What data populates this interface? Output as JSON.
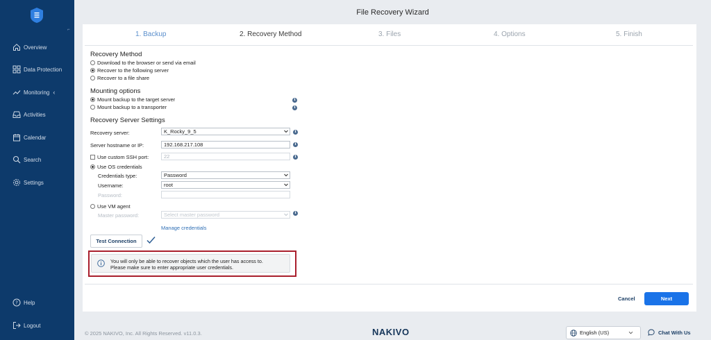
{
  "window_title": "File Recovery Wizard",
  "sidebar": {
    "items": [
      {
        "label": "Overview",
        "icon": "home-icon"
      },
      {
        "label": "Data Protection",
        "icon": "grid-icon"
      },
      {
        "label": "Monitoring",
        "icon": "trend-icon"
      },
      {
        "label": "Activities",
        "icon": "inbox-icon"
      },
      {
        "label": "Calendar",
        "icon": "calendar-icon"
      },
      {
        "label": "Search",
        "icon": "search-icon"
      },
      {
        "label": "Settings",
        "icon": "gear-icon"
      }
    ],
    "bottom_items": [
      {
        "label": "Help",
        "icon": "help-icon"
      },
      {
        "label": "Logout",
        "icon": "logout-icon"
      }
    ]
  },
  "steps": [
    "1. Backup",
    "2. Recovery Method",
    "3. Files",
    "4. Options",
    "5. Finish"
  ],
  "recovery_method": {
    "title": "Recovery Method",
    "options": [
      "Download to the browser or send via email",
      "Recover to the following server",
      "Recover to a file share"
    ],
    "selected": "Recover to the following server"
  },
  "mounting": {
    "title": "Mounting options",
    "options": [
      "Mount backup to the target server",
      "Mount backup to a transporter"
    ],
    "selected": "Mount backup to the target server"
  },
  "server_settings": {
    "title": "Recovery Server Settings",
    "recovery_server_label": "Recovery server:",
    "recovery_server_value": "K_Rocky_9_5",
    "hostname_label": "Server hostname or IP:",
    "hostname_value": "192.168.217.108",
    "ssh_port_label": "Use custom SSH port:",
    "ssh_port_value": "22",
    "os_credentials_label": "Use OS credentials",
    "credentials_type_label": "Credentials type:",
    "credentials_type_value": "Password",
    "username_label": "Username:",
    "username_value": "root",
    "password_label": "Password:",
    "password_value": "",
    "vm_agent_label": "Use VM agent",
    "master_password_label": "Master password:",
    "master_password_placeholder": "Select master password",
    "manage_credentials": "Manage credentials"
  },
  "test_connection": "Test Connection",
  "notice": {
    "line1": "You will only be able to recover objects which the user has access to.",
    "line2": "Please make sure to enter appropriate user credentials."
  },
  "buttons": {
    "cancel": "Cancel",
    "next": "Next"
  },
  "footer": {
    "copyright": "© 2025 NAKIVO, Inc. All Rights Reserved. v11.0.3.",
    "brand": "NAKIVO",
    "language": "English (US)",
    "chat": "Chat With Us"
  },
  "colors": {
    "sidebar": "#0d3a6b",
    "accent": "#1a73e8",
    "highlight_frame": "#a91e2c"
  }
}
